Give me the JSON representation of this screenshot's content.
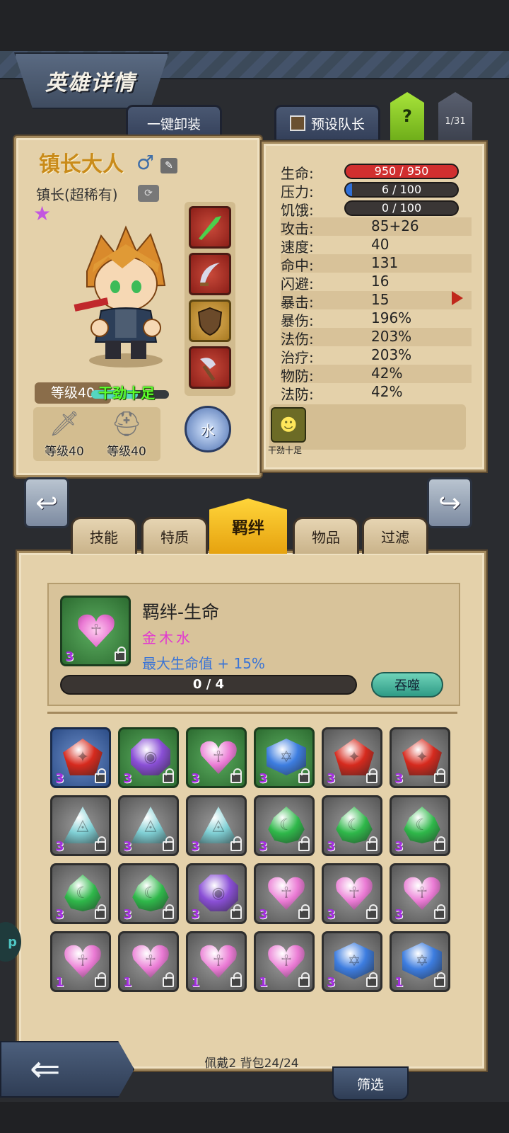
{
  "header": {
    "title": "英雄详情"
  },
  "top_tabs": {
    "unequip_all": "一键卸装",
    "preset_leader": "预设队长",
    "help": "?",
    "hero_index": "1/31"
  },
  "hero": {
    "name": "镇长大人",
    "class": "镇长(超稀有)",
    "level_label": "等级40",
    "mood_label": "干劲十足",
    "mood_level": 0.6,
    "weapon_level": "等级40",
    "armor_level": "等级40",
    "element": "水"
  },
  "stats": {
    "hp": {
      "label": "生命:",
      "value": "950 / 950",
      "fill": 1.0,
      "color": "#d12f2f"
    },
    "stress": {
      "label": "压力:",
      "value": "6 / 100",
      "fill": 0.06,
      "color": "#2f6fd6"
    },
    "hunger": {
      "label": "饥饿:",
      "value": "0 / 100",
      "fill": 0.0,
      "color": "#c9a23a"
    },
    "rows": [
      {
        "label": "攻击:",
        "value": "85+26"
      },
      {
        "label": "速度:",
        "value": "40"
      },
      {
        "label": "命中:",
        "value": "131"
      },
      {
        "label": "闪避:",
        "value": "16"
      },
      {
        "label": "暴击:",
        "value": "15"
      },
      {
        "label": "暴伤:",
        "value": "196%"
      },
      {
        "label": "法伤:",
        "value": "203%"
      },
      {
        "label": "治疗:",
        "value": "203%"
      },
      {
        "label": "物防:",
        "value": "42%"
      },
      {
        "label": "法防:",
        "value": "42%"
      }
    ],
    "trait_label": "干劲十足"
  },
  "tabs": [
    {
      "label": "技能"
    },
    {
      "label": "特质"
    },
    {
      "label": "羁绊"
    },
    {
      "label": "物品"
    },
    {
      "label": "过滤"
    }
  ],
  "bond": {
    "name": "羁绊-生命",
    "elements": "金木水",
    "effect": "最大生命值 + 15%",
    "gem_count": "3",
    "progress": "0 / 4",
    "devour_label": "吞噬"
  },
  "gems": [
    {
      "shape": "pent",
      "color": "#d62a1e",
      "bg": "blue",
      "count": "3"
    },
    {
      "shape": "oct",
      "color": "#8a4fd6",
      "bg": "green",
      "count": "3"
    },
    {
      "shape": "heart",
      "color": "#ea7ad4",
      "bg": "green",
      "count": "3"
    },
    {
      "shape": "hex",
      "color": "#3d7de0",
      "bg": "green",
      "count": "3"
    },
    {
      "shape": "pent",
      "color": "#d62a1e",
      "bg": "gray",
      "count": "3"
    },
    {
      "shape": "pent",
      "color": "#d62a1e",
      "bg": "gray",
      "count": "3"
    },
    {
      "shape": "tri",
      "color": "#7fcfd4",
      "bg": "gray",
      "count": "3"
    },
    {
      "shape": "tri",
      "color": "#7fcfd4",
      "bg": "gray",
      "count": "3"
    },
    {
      "shape": "tri",
      "color": "#7fcfd4",
      "bg": "gray",
      "count": "3"
    },
    {
      "shape": "drop",
      "color": "#2fb84a",
      "bg": "gray",
      "count": "3"
    },
    {
      "shape": "drop",
      "color": "#2fb84a",
      "bg": "gray",
      "count": "3"
    },
    {
      "shape": "drop",
      "color": "#2fb84a",
      "bg": "gray",
      "count": "3"
    },
    {
      "shape": "drop",
      "color": "#2fb84a",
      "bg": "gray",
      "count": "3"
    },
    {
      "shape": "drop",
      "color": "#2fb84a",
      "bg": "gray",
      "count": "3"
    },
    {
      "shape": "oct",
      "color": "#8a4fd6",
      "bg": "gray",
      "count": "3"
    },
    {
      "shape": "heart",
      "color": "#ea7ad4",
      "bg": "gray",
      "count": "3"
    },
    {
      "shape": "heart",
      "color": "#ea7ad4",
      "bg": "gray",
      "count": "3"
    },
    {
      "shape": "heart",
      "color": "#ea7ad4",
      "bg": "gray",
      "count": "3"
    },
    {
      "shape": "heart",
      "color": "#ea7ad4",
      "bg": "gray",
      "count": "1"
    },
    {
      "shape": "heart",
      "color": "#ea7ad4",
      "bg": "gray",
      "count": "1"
    },
    {
      "shape": "heart",
      "color": "#ea7ad4",
      "bg": "gray",
      "count": "1"
    },
    {
      "shape": "heart",
      "color": "#ea7ad4",
      "bg": "gray",
      "count": "1"
    },
    {
      "shape": "hex",
      "color": "#3d7de0",
      "bg": "gray",
      "count": "3"
    },
    {
      "shape": "hex",
      "color": "#3d7de0",
      "bg": "gray",
      "count": "1"
    }
  ],
  "footer": {
    "status": "佩戴2 背包24/24",
    "filter_label": "筛选",
    "side_badge": "p"
  }
}
